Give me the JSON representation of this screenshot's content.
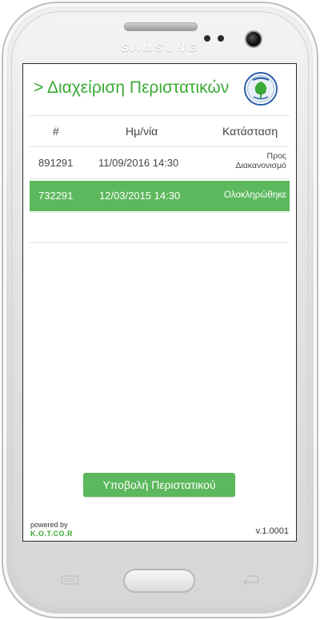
{
  "device": {
    "brand": "SAMSUNG"
  },
  "app": {
    "title": "> Διαχείριση Περιστατικών",
    "logo_icon": "organization-logo-icon",
    "accent_color": "#3aaa35"
  },
  "table": {
    "columns": [
      "#",
      "Ημ/νία",
      "Κατάσταση"
    ],
    "rows": [
      {
        "id": "891291",
        "date": "11/09/2016 14:30",
        "status_line1": "Προς",
        "status_line2": "Διακανονισμό",
        "selected": false
      },
      {
        "id": "732291",
        "date": "12/03/2015 14:30",
        "status": "Ολοκληρώθηκε",
        "selected": true
      }
    ],
    "selected_color": "#5cb85c"
  },
  "actions": {
    "submit_label": "Υποβολή Περιστατικού"
  },
  "footer": {
    "powered_by": "powered by",
    "company": "K.O.T.CO.R",
    "version": "v.1.0001"
  }
}
